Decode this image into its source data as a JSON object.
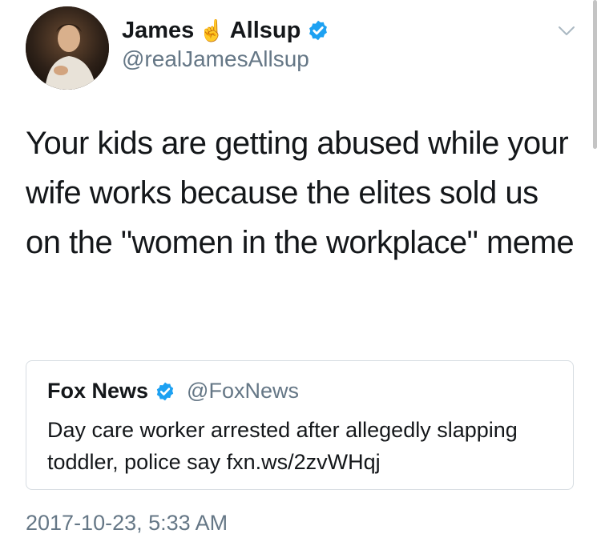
{
  "author": {
    "name_first": "James",
    "emoji": "☝️",
    "name_last": "Allsup",
    "handle": "@realJamesAllsup",
    "verified": true
  },
  "tweet": {
    "text": "Your kids are getting abused while your wife works because the elites sold us on the \"women in the workplace\" meme"
  },
  "quote": {
    "name": "Fox News",
    "verified": true,
    "handle": "@FoxNews",
    "text": "Day care worker arrested after allegedly slapping toddler, police say fxn.ws/2zvWHqj"
  },
  "timestamp": "2017-10-23, 5:33 AM",
  "colors": {
    "verified_blue": "#1da1f2",
    "secondary_text": "#657786",
    "card_border": "#d7dde2"
  },
  "icons": {
    "verified": "verified-badge-icon",
    "menu": "chevron-down-icon"
  }
}
